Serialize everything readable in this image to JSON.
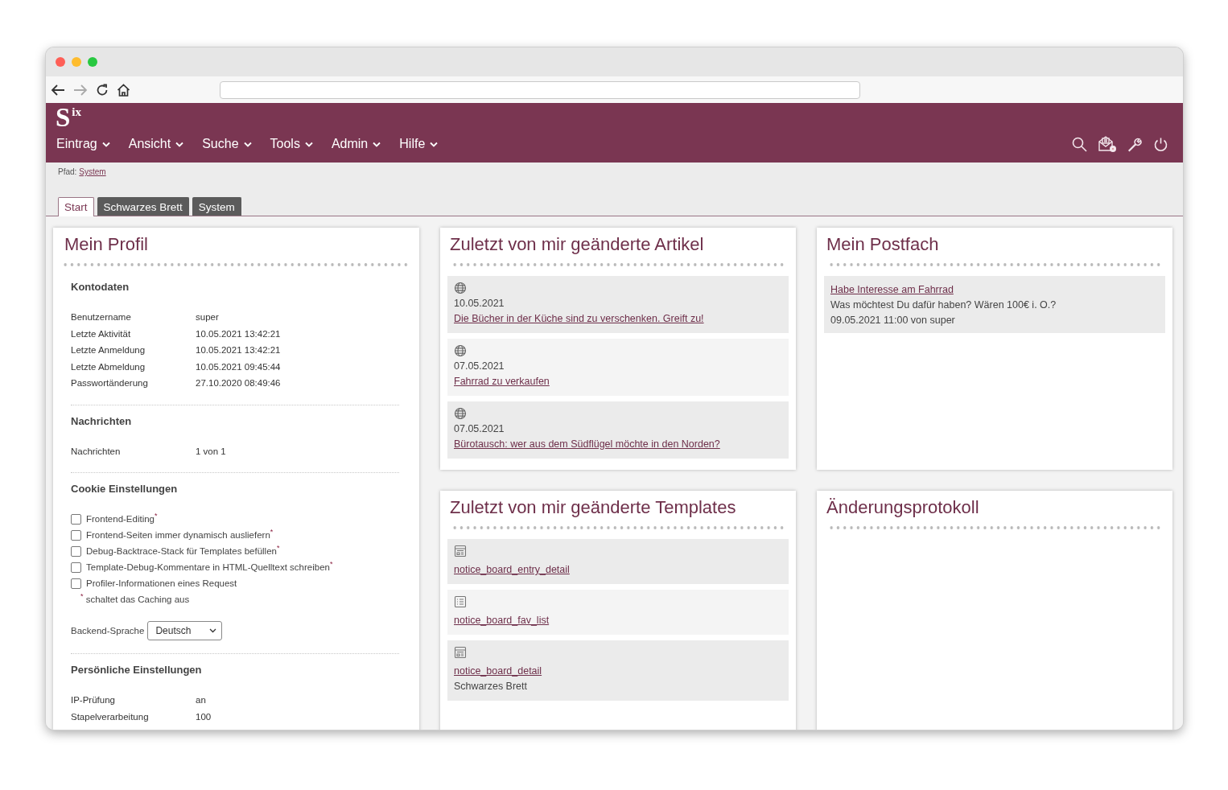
{
  "logo": "S$^{ix}$",
  "menu": [
    {
      "label": "Eintrag"
    },
    {
      "label": "Ansicht"
    },
    {
      "label": "Suche"
    },
    {
      "label": "Tools"
    },
    {
      "label": "Admin"
    },
    {
      "label": "Hilfe"
    }
  ],
  "path": {
    "label": "Pfad:",
    "link": "System"
  },
  "tabs": [
    {
      "label": "Start",
      "selected": true
    },
    {
      "label": "Schwarzes Brett",
      "selected": false
    },
    {
      "label": "System",
      "selected": false
    }
  ],
  "profile": {
    "title": "Mein Profil",
    "sections": [
      {
        "kind": "fields",
        "heading": "Kontodaten",
        "rows": [
          {
            "label": "Benutzername",
            "value": "super"
          },
          {
            "label": "Letzte Aktivität",
            "value": "10.05.2021 13:42:21"
          },
          {
            "label": "Letzte Anmeldung",
            "value": "10.05.2021 13:42:21"
          },
          {
            "label": "Letzte Abmeldung",
            "value": "10.05.2021 09:45:44"
          },
          {
            "label": "Passwortänderung",
            "value": "27.10.2020 08:49:46"
          }
        ]
      },
      {
        "kind": "fields",
        "heading": "Nachrichten",
        "rows": [
          {
            "label": "Nachrichten",
            "value": "1 von 1"
          }
        ]
      },
      {
        "kind": "cookies",
        "heading": "Cookie Einstellungen",
        "options": [
          {
            "label": "Frontend-Editing$^{*}$",
            "checked": false
          },
          {
            "label": "Frontend-Seiten immer dynamisch ausliefern$^{*}$",
            "checked": false
          },
          {
            "label": "Debug-Backtrace-Stack für Templates befüllen$^{*}$",
            "checked": false
          },
          {
            "label": "Template-Debug-Kommentare in HTML-Quelltext schreiben$^{*}$",
            "checked": false
          },
          {
            "label": "Profiler-Informationen eines Request",
            "checked": false
          }
        ],
        "note": "$^{*}$ schaltet das Caching aus",
        "language": {
          "label": "Backend-Sprache",
          "value": "Deutsch"
        }
      },
      {
        "kind": "fields",
        "heading": "Persönliche Einstellungen",
        "rows": [
          {
            "label": "IP-Prüfung",
            "value": "an"
          },
          {
            "label": "Stapelverarbeitung",
            "value": "100"
          }
        ]
      }
    ]
  },
  "articles": {
    "title": "Zuletzt von mir geänderte Artikel",
    "items": [
      {
        "date": "10.05.2021",
        "link": "Die Bücher in der Küche sind zu verschenken. Greift zu!"
      },
      {
        "date": "07.05.2021",
        "link": "Fahrrad zu verkaufen"
      },
      {
        "date": "07.05.2021",
        "link": "Bürotausch: wer aus dem Südflügel möchte in den Norden?"
      }
    ]
  },
  "mailbox": {
    "title": "Mein Postfach",
    "items": [
      {
        "subject": "Habe Interesse am Fahrrad",
        "text": "Was möchtest Du dafür haben? Wären 100€ i. O.?",
        "meta": "09.05.2021 11:00 von super"
      }
    ]
  },
  "templates": {
    "title": "Zuletzt von mir geänderte Templates",
    "items": [
      {
        "kind": "layout",
        "link": "notice_board_entry_detail"
      },
      {
        "kind": "list",
        "link": "notice_board_fav_list"
      },
      {
        "kind": "layout",
        "link": "notice_board_detail",
        "subtitle": "Schwarzes Brett"
      }
    ]
  },
  "changelog": {
    "title": "Änderungsprotokoll"
  }
}
